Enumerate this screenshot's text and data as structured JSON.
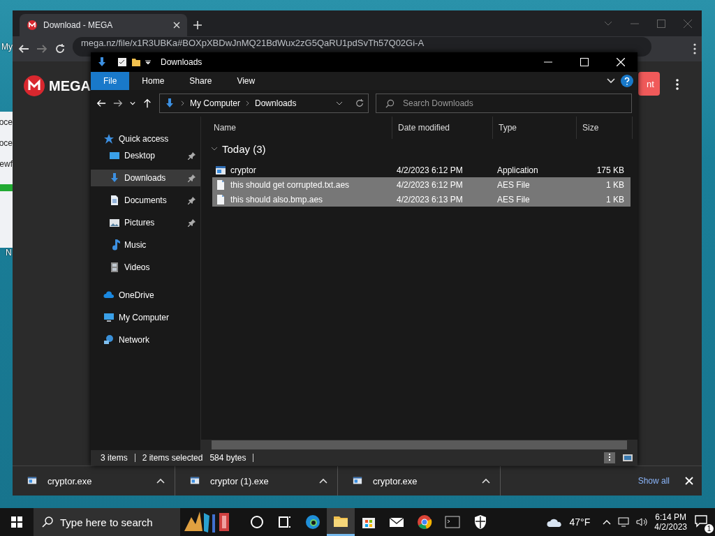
{
  "desktop": {
    "icon_labels": [
      "My",
      "N"
    ]
  },
  "background_window": {
    "texts": [
      "oce",
      "oce",
      "ewf"
    ]
  },
  "browser": {
    "tab": {
      "title": "Download - MEGA"
    },
    "address": "mega.nz/file/x1R3UBKa#BOXpXBDwJnMQ21BdWux2zG5QaRU1pdSvTh57Q02Gi-A",
    "logo": "MEGA",
    "button_fragment": "nt",
    "downloads": [
      {
        "name": "cryptor.exe"
      },
      {
        "name": "cryptor (1).exe"
      },
      {
        "name": "cryptor.exe"
      }
    ],
    "show_all": "Show all"
  },
  "explorer": {
    "title": "Downloads",
    "ribbon_tabs": [
      {
        "label": "File",
        "selected": true
      },
      {
        "label": "Home",
        "selected": false
      },
      {
        "label": "Share",
        "selected": false
      },
      {
        "label": "View",
        "selected": false
      }
    ],
    "breadcrumb": [
      "My Computer",
      "Downloads"
    ],
    "search": {
      "placeholder": "Search Downloads"
    },
    "nav": [
      {
        "label": "Quick access",
        "kind": "star",
        "selected": false,
        "children": [
          {
            "label": "Desktop",
            "kind": "desktop",
            "pinned": true,
            "selected": false
          },
          {
            "label": "Downloads",
            "kind": "download",
            "pinned": true,
            "selected": true
          },
          {
            "label": "Documents",
            "kind": "document",
            "pinned": true,
            "selected": false
          },
          {
            "label": "Pictures",
            "kind": "pictures",
            "pinned": true,
            "selected": false
          },
          {
            "label": "Music",
            "kind": "music",
            "pinned": false,
            "selected": false
          },
          {
            "label": "Videos",
            "kind": "videos",
            "pinned": false,
            "selected": false
          }
        ]
      },
      {
        "label": "OneDrive",
        "kind": "cloud",
        "selected": false
      },
      {
        "label": "My Computer",
        "kind": "computer",
        "selected": false
      },
      {
        "label": "Network",
        "kind": "network",
        "selected": false
      }
    ],
    "columns": [
      "Name",
      "Date modified",
      "Type",
      "Size"
    ],
    "group": {
      "label": "Today (3)",
      "expanded": true
    },
    "rows": [
      {
        "name": "cryptor",
        "kind": "app",
        "date": "4/2/2023 6:12 PM",
        "type": "Application",
        "size": "175 KB",
        "selected": false
      },
      {
        "name": "this should get corrupted.txt.aes",
        "kind": "file",
        "date": "4/2/2023 6:12 PM",
        "type": "AES File",
        "size": "1 KB",
        "selected": true
      },
      {
        "name": "this should also.bmp.aes",
        "kind": "file",
        "date": "4/2/2023 6:13 PM",
        "type": "AES File",
        "size": "1 KB",
        "selected": true
      }
    ],
    "status": {
      "items": "3 items",
      "selected": "2 items selected",
      "bytes": "584 bytes"
    }
  },
  "taskbar": {
    "search_placeholder": "Type here to search",
    "apps": [
      {
        "kind": "cortana",
        "active": false
      },
      {
        "kind": "taskview",
        "active": false
      },
      {
        "kind": "edge",
        "active": false
      },
      {
        "kind": "folder",
        "active": true
      },
      {
        "kind": "store",
        "active": false
      },
      {
        "kind": "mail",
        "active": false
      },
      {
        "kind": "chrome",
        "active": false
      },
      {
        "kind": "terminal",
        "active": false
      },
      {
        "kind": "shield",
        "active": false
      }
    ],
    "weather": "47°F",
    "time": "6:14 PM",
    "date": "4/2/2023",
    "notifications": "1"
  }
}
